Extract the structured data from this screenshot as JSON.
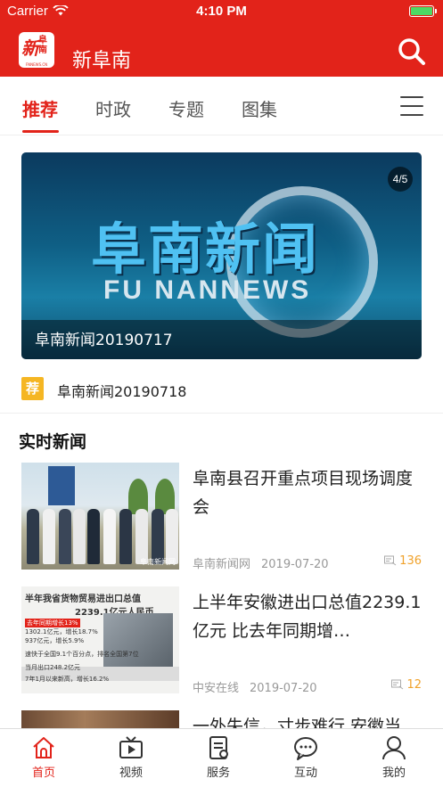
{
  "status_bar": {
    "carrier": "Carrier",
    "time": "4:10 PM"
  },
  "app": {
    "logo_char": "新",
    "logo_small": "阜南",
    "logo_en": "FNNEWS.CN",
    "title": "新阜南"
  },
  "tabs": [
    {
      "label": "推荐",
      "active": true
    },
    {
      "label": "时政",
      "active": false
    },
    {
      "label": "专题",
      "active": false
    },
    {
      "label": "图集",
      "active": false
    }
  ],
  "banner": {
    "counter": "4/5",
    "image_text_cn": "阜南新闻",
    "image_text_en": "FU NANNEWS",
    "caption": "阜南新闻20190717"
  },
  "recommend": {
    "badge": "荐",
    "text": "阜南新闻20190718"
  },
  "section": {
    "title": "实时新闻"
  },
  "news": [
    {
      "title": "阜南县召开重点项目现场调度会",
      "source": "阜南新闻网",
      "date": "2019-07-20",
      "count": "136",
      "thumb_mark": "阜南新闻网"
    },
    {
      "title": "上半年安徽进出口总值2239.1亿元 比去年同期增…",
      "source": "中安在线",
      "date": "2019-07-20",
      "count": "12",
      "thumb_text": {
        "line1": "半年我省货物贸易进出口总值",
        "line2": "2239.1亿元人民币",
        "tag": "去年同期增长13%",
        "l3": "1302.1亿元，增长18.7%",
        "l4": "937亿元，增长5.9%",
        "l5": "速快于全国9.1个百分点，排名全国第7位",
        "l6": "当月出口248.2亿元",
        "l7": "7年1月以来新高，增长16.2%"
      }
    },
    {
      "title": "一外失信，寸步难行 安徽当",
      "source": "",
      "date": "",
      "count": ""
    }
  ],
  "tabbar": [
    {
      "label": "首页",
      "icon": "home-icon",
      "active": true
    },
    {
      "label": "视频",
      "icon": "tv-icon",
      "active": false
    },
    {
      "label": "服务",
      "icon": "service-icon",
      "active": false
    },
    {
      "label": "互动",
      "icon": "chat-icon",
      "active": false
    },
    {
      "label": "我的",
      "icon": "user-icon",
      "active": false
    }
  ],
  "colors": {
    "brand_red": "#e2231a",
    "badge_yellow": "#f5b623",
    "count_orange": "#f0a22c"
  }
}
